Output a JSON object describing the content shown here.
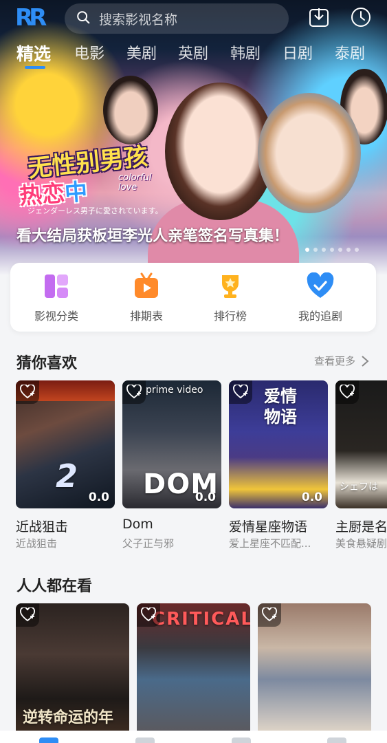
{
  "header": {
    "logo": "RR",
    "search_placeholder": "搜索影视名称",
    "download_icon": "download-icon",
    "history_icon": "clock-icon"
  },
  "tabs": [
    {
      "label": "精选",
      "active": true
    },
    {
      "label": "电影"
    },
    {
      "label": "美剧"
    },
    {
      "label": "英剧"
    },
    {
      "label": "韩剧"
    },
    {
      "label": "日剧"
    },
    {
      "label": "泰剧"
    }
  ],
  "banner": {
    "title": "无性别男孩",
    "subtitle_a": "热恋",
    "subtitle_b": "中",
    "eng": "colorful love",
    "jp": "ジェンダーレス男子に愛されています。",
    "caption": "看大结局获板垣李光人亲笔签名写真集！",
    "dot_count": 7,
    "active_dot": 0
  },
  "quick_actions": [
    {
      "label": "影视分类",
      "icon": "category-icon",
      "color": "#c36cf0"
    },
    {
      "label": "排期表",
      "icon": "schedule-tv-icon",
      "color": "#ff8a2a"
    },
    {
      "label": "排行榜",
      "icon": "trophy-icon",
      "color": "#ffb21e"
    },
    {
      "label": "我的追剧",
      "icon": "heart-badge-icon",
      "color": "#2e8df5"
    }
  ],
  "sections": {
    "guess": {
      "title": "猜你喜欢",
      "more": "查看更多",
      "items": [
        {
          "title": "近战狙击",
          "sub": "近战狙击",
          "score": "0.0",
          "poster_text": "2"
        },
        {
          "title": "Dom",
          "sub": "父子正与邪",
          "score": "0.0",
          "poster_text": "DOM",
          "brand": "prime video"
        },
        {
          "title": "爱情星座物语",
          "sub": "爱上星座不匹配...",
          "score": "0.0",
          "poster_text": "爱情 物语"
        },
        {
          "title": "主厨是名",
          "sub": "美食悬疑剧",
          "score": "",
          "poster_text": "シェフは"
        }
      ]
    },
    "watching": {
      "title": "人人都在看",
      "items": [
        {
          "poster_text": "逆转命运的年"
        },
        {
          "poster_text": "CRITICAL"
        },
        {
          "poster_text": ""
        }
      ]
    }
  },
  "tabbar": {
    "item_count": 4,
    "active": 0
  }
}
